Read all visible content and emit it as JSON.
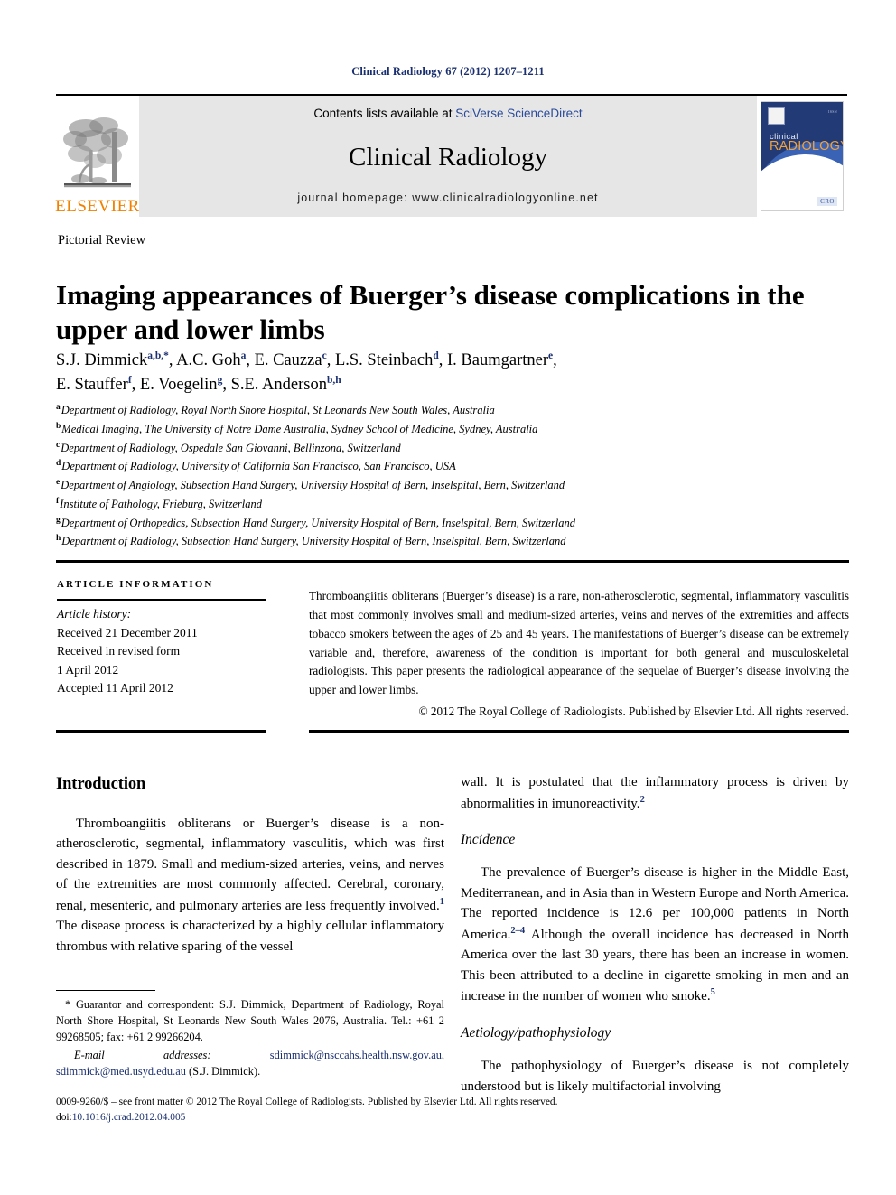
{
  "running_head": "Clinical Radiology 67 (2012) 1207–1211",
  "masthead": {
    "publisher_logo_text": "ELSEVIER",
    "contents_prefix": "Contents lists available at ",
    "contents_link": "SciVerse ScienceDirect",
    "journal_title": "Clinical Radiology",
    "homepage": "journal homepage: www.clinicalradiologyonline.net",
    "cover": {
      "line1": "clinical",
      "line2": "RADIOLOGY",
      "badge": "CRO"
    }
  },
  "article": {
    "doc_type": "Pictorial Review",
    "title": "Imaging appearances of Buerger’s disease complications in the upper and lower limbs",
    "authors_line1": "S.J. Dimmick",
    "authors": [
      {
        "name": "S.J. Dimmick",
        "marks": "a,b,*"
      },
      {
        "name": "A.C. Goh",
        "marks": "a"
      },
      {
        "name": "E. Cauzza",
        "marks": "c"
      },
      {
        "name": "L.S. Steinbach",
        "marks": "d"
      },
      {
        "name": "I. Baumgartner",
        "marks": "e"
      },
      {
        "name": "E. Stauffer",
        "marks": "f"
      },
      {
        "name": "E. Voegelin",
        "marks": "g"
      },
      {
        "name": "S.E. Anderson",
        "marks": "b,h"
      }
    ],
    "affiliations": [
      {
        "mark": "a",
        "text": "Department of Radiology, Royal North Shore Hospital, St Leonards New South Wales, Australia"
      },
      {
        "mark": "b",
        "text": "Medical Imaging, The University of Notre Dame Australia, Sydney School of Medicine, Sydney, Australia"
      },
      {
        "mark": "c",
        "text": "Department of Radiology, Ospedale San Giovanni, Bellinzona, Switzerland"
      },
      {
        "mark": "d",
        "text": "Department of Radiology, University of California San Francisco, San Francisco, USA"
      },
      {
        "mark": "e",
        "text": "Department of Angiology, Subsection Hand Surgery, University Hospital of Bern, Inselspital, Bern, Switzerland"
      },
      {
        "mark": "f",
        "text": "Institute of Pathology, Frieburg, Switzerland"
      },
      {
        "mark": "g",
        "text": "Department of Orthopedics, Subsection Hand Surgery, University Hospital of Bern, Inselspital, Bern, Switzerland"
      },
      {
        "mark": "h",
        "text": "Department of Radiology, Subsection Hand Surgery, University Hospital of Bern, Inselspital, Bern, Switzerland"
      }
    ]
  },
  "article_info": {
    "heading": "Article information",
    "history_label": "Article history:",
    "lines": [
      "Received 21 December 2011",
      "Received in revised form",
      "1 April 2012",
      "Accepted 11 April 2012"
    ]
  },
  "abstract": {
    "text": "Thromboangiitis obliterans (Buerger’s disease) is a rare, non-atherosclerotic, segmental, inflammatory vasculitis that most commonly involves small and medium-sized arteries, veins and nerves of the extremities and affects tobacco smokers between the ages of 25 and 45 years. The manifestations of Buerger’s disease can be extremely variable and, therefore, awareness of the condition is important for both general and musculoskeletal radiologists. This paper presents the radiological appearance of the sequelae of Buerger’s disease involving the upper and lower limbs.",
    "copyright": "© 2012 The Royal College of Radiologists. Published by Elsevier Ltd. All rights reserved."
  },
  "body": {
    "left": {
      "heading": "Introduction",
      "paragraph_part1": "Thromboangiitis obliterans or Buerger’s disease is a non-atherosclerotic, segmental, inflammatory vasculitis, which was first described in 1879. Small and medium-sized arteries, veins, and nerves of the extremities are most commonly affected. Cerebral, coronary, renal, mesenteric, and pulmonary arteries are less frequently involved.",
      "ref1": "1",
      "paragraph_part2": " The disease process is characterized by a highly cellular inflammatory thrombus with relative sparing of the vessel"
    },
    "right": {
      "cont_part1": "wall. It is postulated that the inflammatory process is driven by abnormalities in imunoreactivity.",
      "cont_ref": "2",
      "heading_incidence": "Incidence",
      "incidence_part1": "The prevalence of Buerger’s disease is higher in the Middle East, Mediterranean, and in Asia than in Western Europe and North America. The reported incidence is 12.6 per 100,000 patients in North America.",
      "incidence_ref1": "2–4",
      "incidence_part2": " Although the overall incidence has decreased in North America over the last 30 years, there has been an increase in women. This been attributed to a decline in cigarette smoking in men and an increase in the number of women who smoke.",
      "incidence_ref2": "5",
      "heading_aetiology": "Aetiology/pathophysiology",
      "aetiology_part1": "The pathophysiology of Buerger’s disease is not completely understood but is likely multifactorial involving"
    }
  },
  "footnote": {
    "correspondence": "* Guarantor and correspondent: S.J. Dimmick, Department of Radiology, Royal North Shore Hospital, St Leonards New South Wales 2076, Australia. Tel.: +61 2 99268505; fax: +61 2 99266204.",
    "email_label": "E-mail addresses:",
    "email1": "sdimmick@nsccahs.health.nsw.gov.au",
    "email_sep": ", ",
    "email2": "sdimmick@med.usyd.edu.au",
    "email_suffix": " (S.J. Dimmick)."
  },
  "colophon": {
    "issn_line": "0009-9260/$ – see front matter © 2012 The Royal College of Radiologists. Published by Elsevier Ltd. All rights reserved.",
    "doi_label": "doi:",
    "doi_value": "10.1016/j.crad.2012.04.005"
  },
  "colors": {
    "running_head": "#1a2f6f",
    "link": "#1a2f6f",
    "elsevier_orange": "#f08000",
    "masthead_bg": "#e6e6e6",
    "cover_navy": "#223a75"
  }
}
